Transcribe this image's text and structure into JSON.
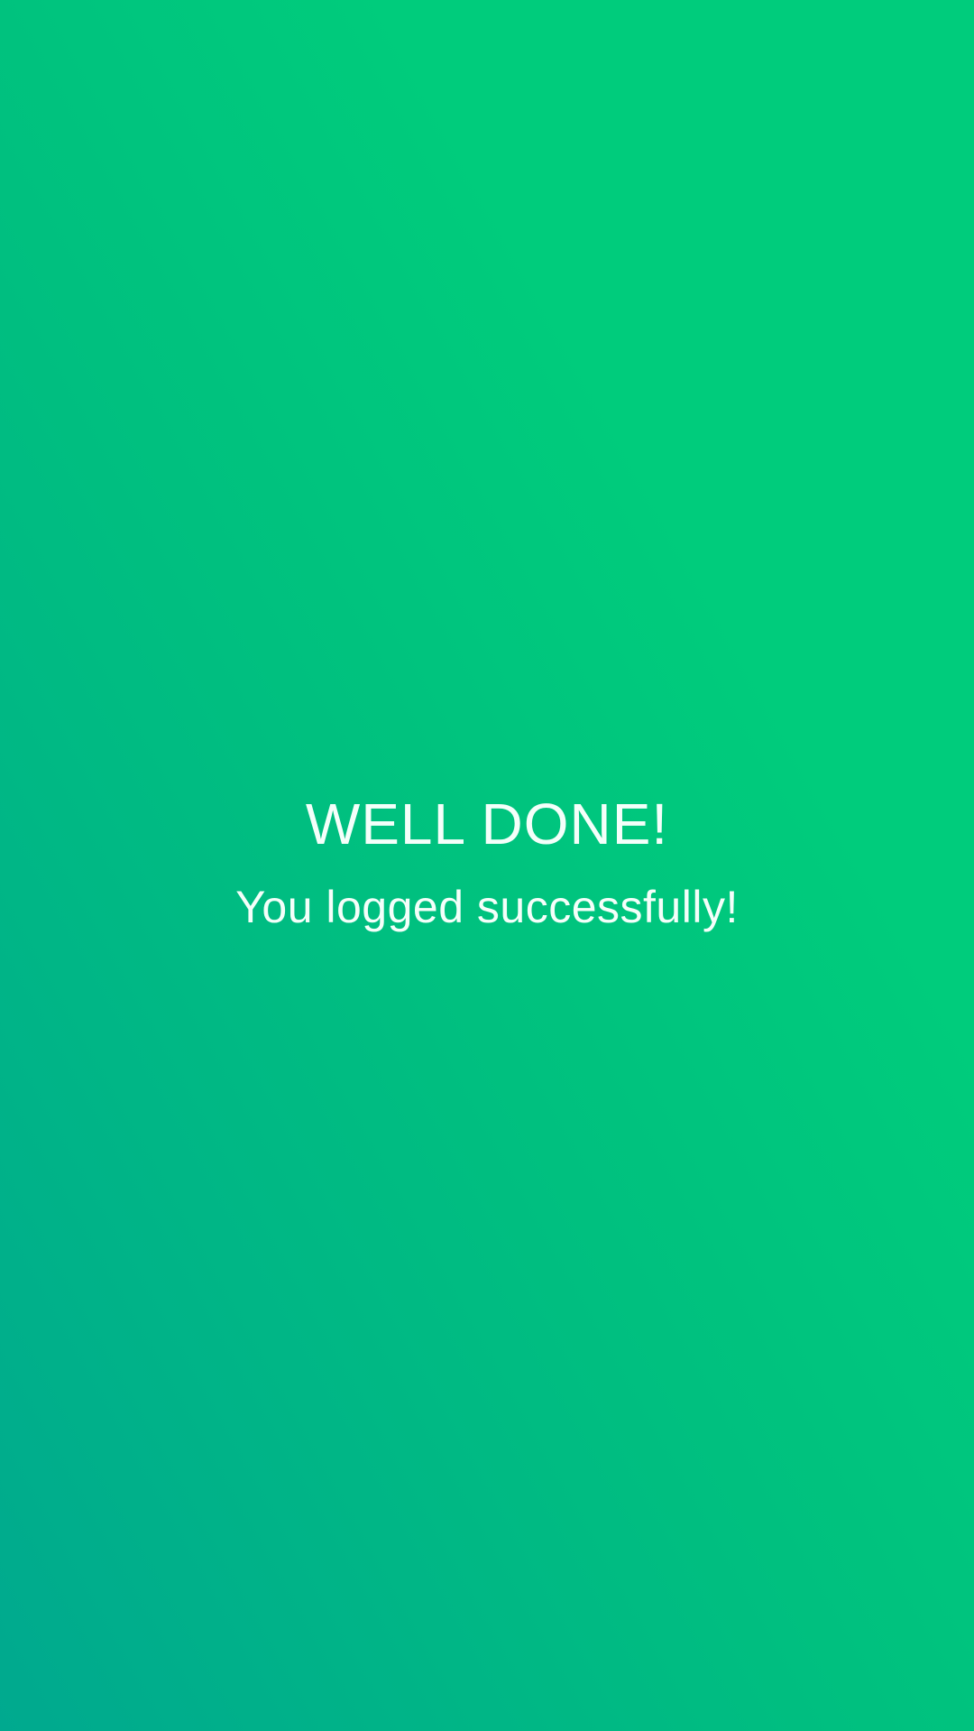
{
  "success_screen": {
    "headline": "WELL DONE!",
    "subtitle": "You logged successfully!"
  },
  "colors": {
    "gradient_top": "#00cc7c",
    "gradient_bottom": "#00a98f",
    "text": "#ffffff"
  }
}
